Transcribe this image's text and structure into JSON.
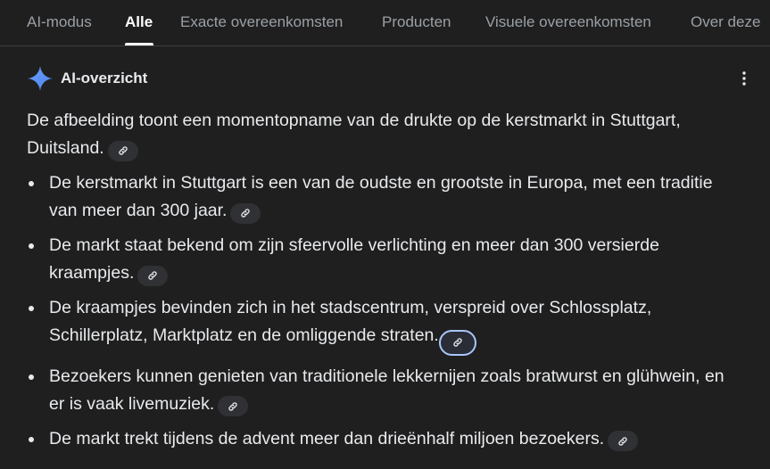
{
  "tabs": [
    {
      "label": "AI-modus",
      "active": false
    },
    {
      "label": "Alle",
      "active": true
    },
    {
      "label": "Exacte overeenkomsten",
      "active": false
    },
    {
      "label": "Producten",
      "active": false
    },
    {
      "label": "Visuele overeenkomsten",
      "active": false
    },
    {
      "label": "Over deze",
      "active": false
    }
  ],
  "overview": {
    "title": "AI-overzicht",
    "icon": "gemini-spark-icon",
    "menu_icon": "more-vert-icon",
    "intro": "De afbeelding toont een momentopname van de drukte op de kerstmarkt in Stuttgart, Duitsland.",
    "bullets": [
      "De kerstmarkt in Stuttgart is een van de oudste en grootste in Europa, met een traditie van meer dan 300 jaar.",
      "De markt staat bekend om zijn sfeervolle verlichting en meer dan 300 versierde kraampjes.",
      "De kraampjes bevinden zich in het stadscentrum, verspreid over Schlossplatz, Schillerplatz, Marktplatz en de omliggende straten.",
      "Bezoekers kunnen genieten van traditionele lekkernijen zoals bratwurst en glühwein, en er is vaak livemuziek.",
      "De markt trekt tijdens de advent meer dan drieënhalf miljoen bezoekers."
    ],
    "citation_icon": "link-icon"
  },
  "colors": {
    "background": "#1f1f1f",
    "text": "#e8eaed",
    "muted": "#9aa0a6",
    "chip": "#303134",
    "focus_ring": "#a8c7fa",
    "spark_blue": "#4f8df7"
  }
}
